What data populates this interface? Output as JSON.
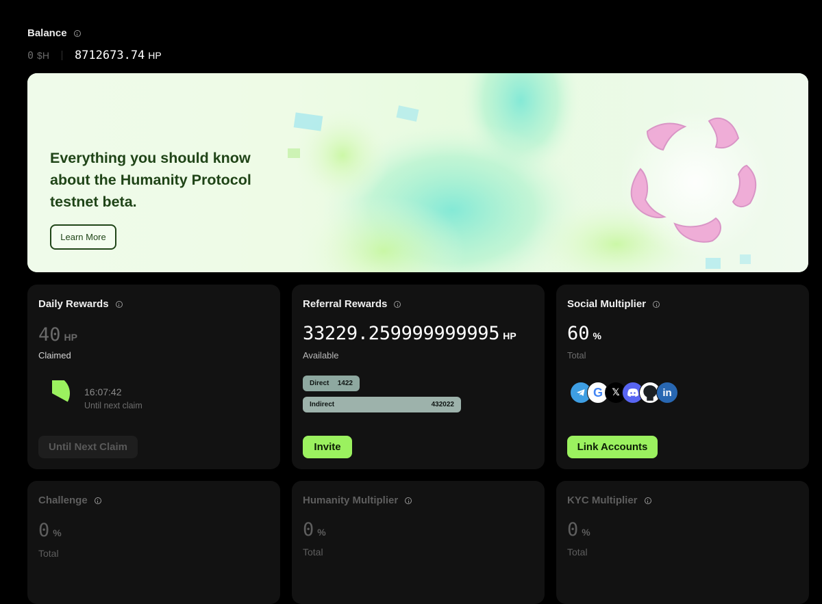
{
  "balance": {
    "title": "Balance",
    "h_value": "0",
    "h_unit": "$H",
    "hp_value": "8712673.74",
    "hp_unit": "HP"
  },
  "banner": {
    "heading": "Everything you should know about the Humanity Protocol testnet beta.",
    "button_label": "Learn More"
  },
  "daily_rewards": {
    "title": "Daily Rewards",
    "value": "40",
    "unit": "HP",
    "status": "Claimed",
    "timer": "16:07:42",
    "timer_label": "Until next claim",
    "timer_progress": 0.33,
    "button_label": "Until Next Claim"
  },
  "referral_rewards": {
    "title": "Referral Rewards",
    "value": "33229.259999999995",
    "unit": "HP",
    "status": "Available",
    "direct_label": "Direct",
    "direct_value": "1422",
    "indirect_label": "Indirect",
    "indirect_value": "432022",
    "button_label": "Invite"
  },
  "social_multiplier": {
    "title": "Social Multiplier",
    "value": "60",
    "unit": "%",
    "status": "Total",
    "icons": [
      "telegram-icon",
      "google-icon",
      "x-icon",
      "discord-icon",
      "github-icon",
      "linkedin-icon"
    ],
    "button_label": "Link Accounts"
  },
  "challenge": {
    "title": "Challenge",
    "value": "0",
    "unit": "%",
    "status": "Total"
  },
  "humanity_multiplier": {
    "title": "Humanity Multiplier",
    "value": "0",
    "unit": "%",
    "status": "Total"
  },
  "kyc_multiplier": {
    "title": "KYC Multiplier",
    "value": "0",
    "unit": "%",
    "status": "Total"
  },
  "colors": {
    "accent_green": "#9bf15f",
    "banner_text": "#1f4417",
    "card_bg": "#121212",
    "pill": "#8ea8a0"
  }
}
